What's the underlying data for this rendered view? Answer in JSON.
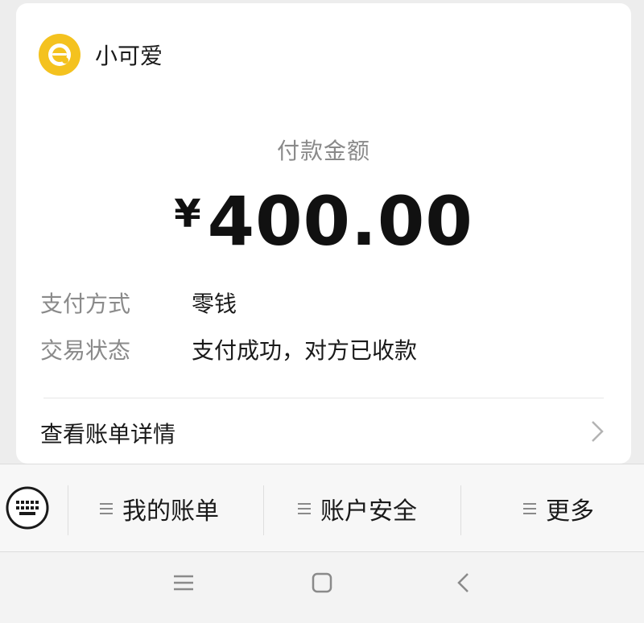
{
  "merchant": {
    "name": "小可爱",
    "avatar_icon": "bear-face-icon",
    "avatar_color": "#f4c21f"
  },
  "payment": {
    "amount_label": "付款金额",
    "currency": "¥",
    "amount": "400.00"
  },
  "details": [
    {
      "label": "支付方式",
      "value": "零钱"
    },
    {
      "label": "交易状态",
      "value": "支付成功，对方已收款"
    }
  ],
  "bill_detail": {
    "label": "查看账单详情"
  },
  "bottom_menu": {
    "keyboard_icon": "keyboard-icon",
    "items": [
      {
        "label": "我的账单"
      },
      {
        "label": "账户安全"
      },
      {
        "label": "更多"
      }
    ]
  },
  "system_nav": {
    "icons": [
      "menu-icon",
      "home-square-icon",
      "back-chevron-icon"
    ]
  }
}
